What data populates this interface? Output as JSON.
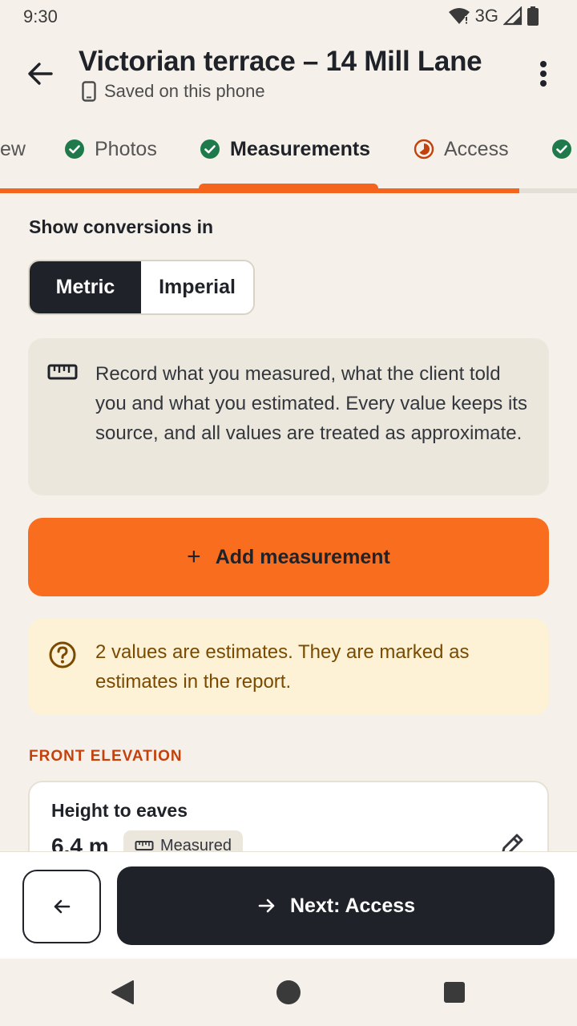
{
  "status_bar": {
    "time": "9:30",
    "network": "3G"
  },
  "header": {
    "title": "Victorian terrace – 14 Mill Lane",
    "subtitle": "Saved on this phone"
  },
  "tabs": [
    {
      "label": "ew",
      "state": "partial-offscreen"
    },
    {
      "label": "Photos",
      "state": "complete"
    },
    {
      "label": "Measurements",
      "state": "complete",
      "active": true
    },
    {
      "label": "Access",
      "state": "in-progress"
    },
    {
      "label": "",
      "state": "complete"
    }
  ],
  "progress": {
    "fraction": 0.9
  },
  "conversions": {
    "label": "Show conversions in",
    "options": [
      "Metric",
      "Imperial"
    ],
    "selected": "Metric"
  },
  "info_card": {
    "icon": "ruler-icon",
    "text": "Record what you measured, what the client told you and what you estimated. Every value keeps its source, and all values are treated as approximate."
  },
  "add_button": {
    "label": "Add measurement"
  },
  "estimate_notice": {
    "icon": "help-circle-icon",
    "text": "2 values are estimates. They are marked as estimates in the report."
  },
  "group": {
    "title": "FRONT ELEVATION",
    "items": [
      {
        "name": "Height to eaves",
        "value": "6.4 m",
        "source": "Measured"
      }
    ]
  },
  "footer": {
    "next_label": "Next: Access"
  },
  "colors": {
    "accent": "#f4641d",
    "dark": "#1f2228",
    "success": "#1e7a4a",
    "warning": "#c2410c",
    "background": "#f5f1ea"
  }
}
